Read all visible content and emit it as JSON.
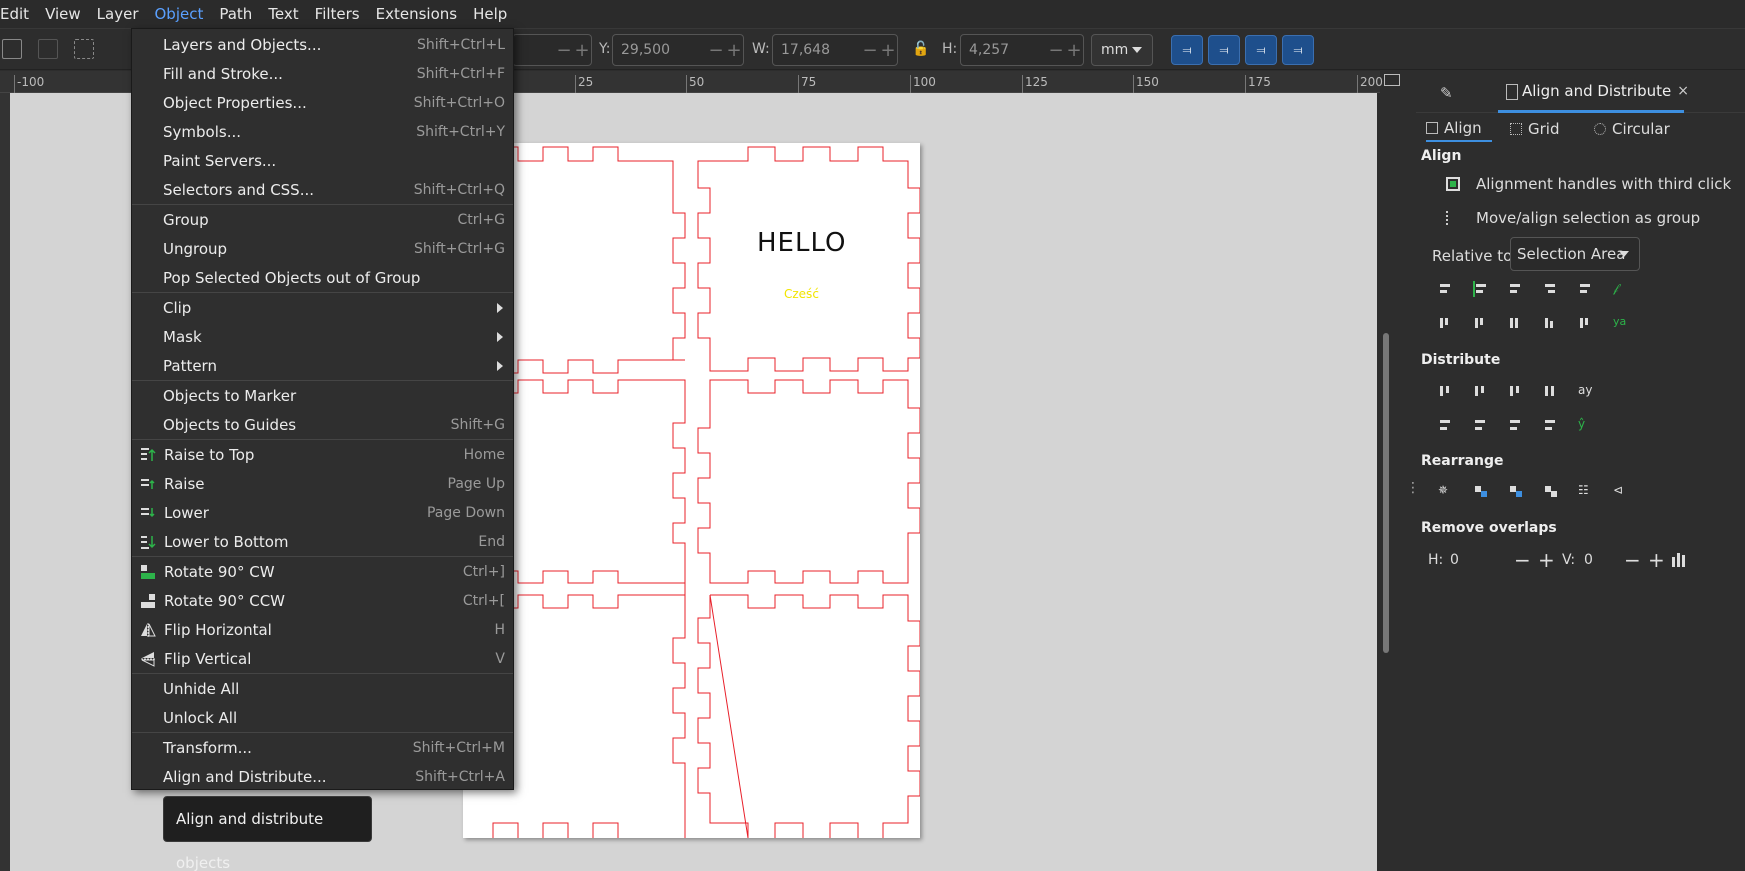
{
  "menubar": {
    "items": [
      "Edit",
      "View",
      "Layer",
      "Object",
      "Path",
      "Text",
      "Filters",
      "Extensions",
      "Help"
    ],
    "active_index": 3
  },
  "toolbar": {
    "y_label": "Y:",
    "y_value": "29,500",
    "w_label": "W:",
    "w_value": "17,648",
    "h_label": "H:",
    "h_value": "4,257",
    "unit": "mm"
  },
  "ruler": {
    "ticks": [
      "-100",
      "25",
      "50",
      "75",
      "100",
      "125",
      "150",
      "175",
      "200"
    ]
  },
  "canvas": {
    "heading_text": "HELLO",
    "sub_text": "Cześć"
  },
  "object_menu": {
    "items": [
      {
        "label": "Layers and Objects...",
        "shortcut": "Shift+Ctrl+L"
      },
      {
        "label": "Fill and Stroke...",
        "shortcut": "Shift+Ctrl+F"
      },
      {
        "label": "Object Properties...",
        "shortcut": "Shift+Ctrl+O"
      },
      {
        "label": "Symbols...",
        "shortcut": "Shift+Ctrl+Y"
      },
      {
        "label": "Paint Servers...",
        "shortcut": ""
      },
      {
        "label": "Selectors and CSS...",
        "shortcut": "Shift+Ctrl+Q"
      },
      {
        "label": "Group",
        "shortcut": "Ctrl+G"
      },
      {
        "label": "Ungroup",
        "shortcut": "Shift+Ctrl+G"
      },
      {
        "label": "Pop Selected Objects out of Group",
        "shortcut": ""
      },
      {
        "label": "Clip",
        "shortcut": ""
      },
      {
        "label": "Mask",
        "shortcut": ""
      },
      {
        "label": "Pattern",
        "shortcut": ""
      },
      {
        "label": "Objects to Marker",
        "shortcut": ""
      },
      {
        "label": "Objects to Guides",
        "shortcut": "Shift+G"
      },
      {
        "label": "Raise to Top",
        "shortcut": "Home"
      },
      {
        "label": "Raise",
        "shortcut": "Page Up"
      },
      {
        "label": "Lower",
        "shortcut": "Page Down"
      },
      {
        "label": "Lower to Bottom",
        "shortcut": "End"
      },
      {
        "label": "Rotate 90° CW",
        "shortcut": "Ctrl+]"
      },
      {
        "label": "Rotate 90° CCW",
        "shortcut": "Ctrl+["
      },
      {
        "label": "Flip Horizontal",
        "shortcut": "H"
      },
      {
        "label": "Flip Vertical",
        "shortcut": "V"
      },
      {
        "label": "Unhide All",
        "shortcut": ""
      },
      {
        "label": "Unlock All",
        "shortcut": ""
      },
      {
        "label": "Transform...",
        "shortcut": "Shift+Ctrl+M"
      },
      {
        "label": "Align and Distribute...",
        "shortcut": "Shift+Ctrl+A"
      }
    ]
  },
  "tooltip": {
    "text": "Align and distribute objects"
  },
  "panel": {
    "tab_title": "Align and Distribute",
    "close_glyph": "×",
    "subtabs": [
      "Align",
      "Grid",
      "Circular"
    ],
    "align_heading": "Align",
    "opt_third_click": "Alignment handles with third click",
    "opt_group": "Move/align selection as group",
    "relative_label": "Relative to:",
    "relative_value": "Selection Area",
    "distribute_heading": "Distribute",
    "rearrange_heading": "Rearrange",
    "overlaps_heading": "Remove overlaps",
    "h_label": "H:",
    "h_value": "0",
    "v_label": "V:",
    "v_value": "0"
  },
  "colors": {
    "accent": "#3d8fe0",
    "cut_lines": "#e8202a",
    "sub_text": "#f2e500"
  }
}
